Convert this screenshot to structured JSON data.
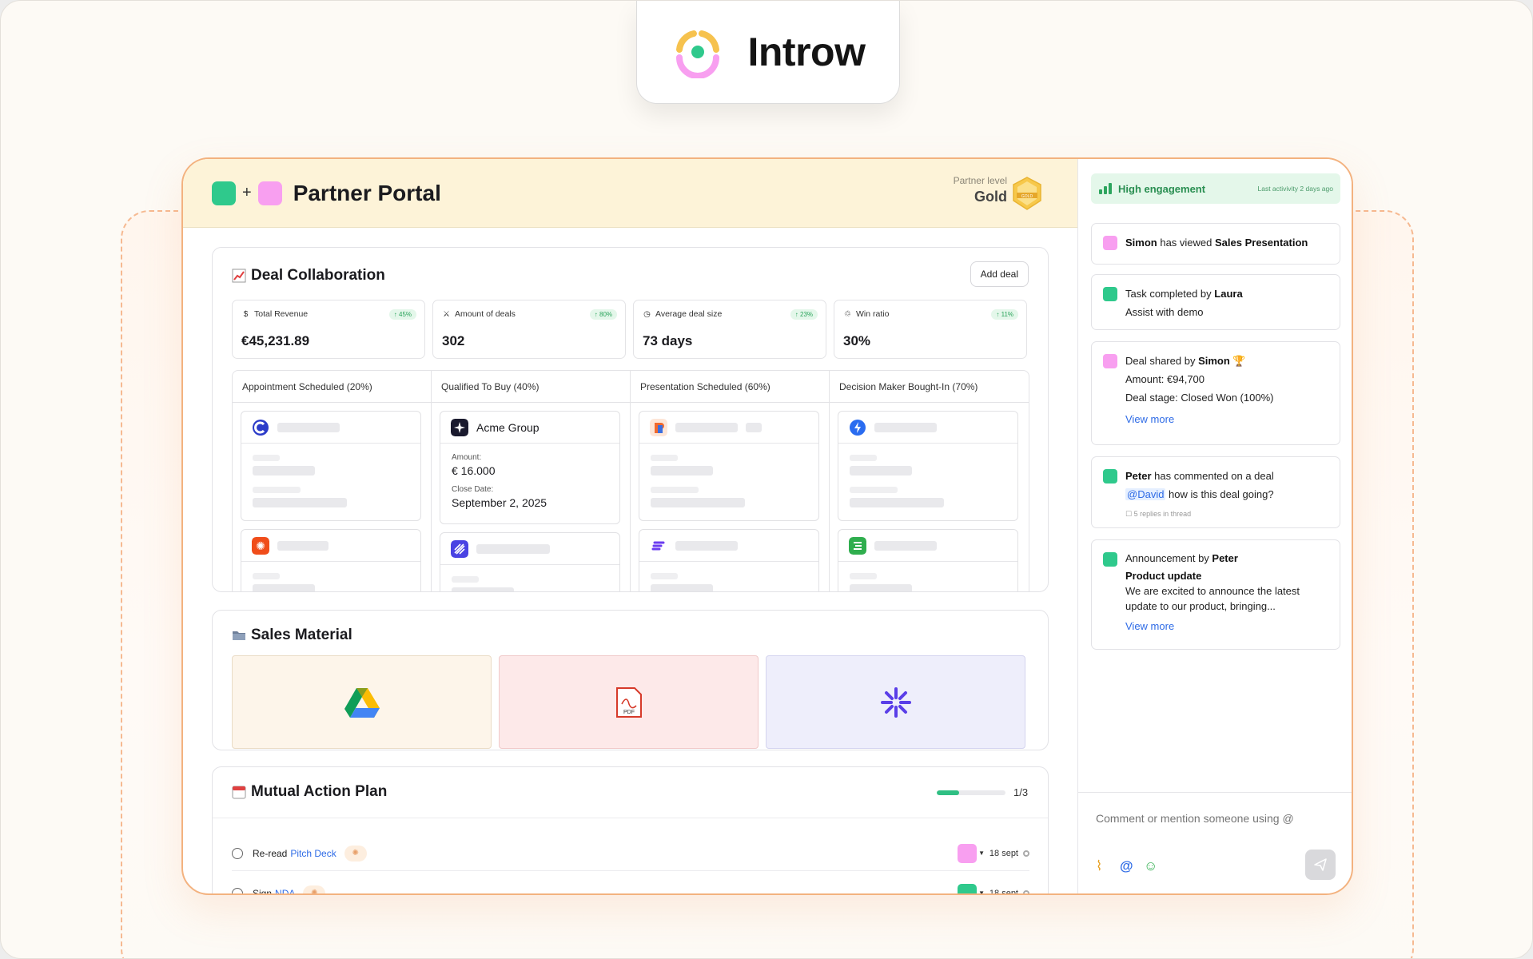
{
  "brand": {
    "name": "Introw"
  },
  "header": {
    "title": "Partner Portal",
    "plus": "+",
    "partner_label": "Partner level",
    "partner_value": "Gold",
    "badge_text": "GOLD"
  },
  "deal_collab": {
    "title": "Deal Collaboration",
    "add_button": "Add deal",
    "kpis": [
      {
        "icon": "dollar-icon",
        "glyph": "$",
        "label": "Total Revenue",
        "change": "↑ 45%",
        "value": "€45,231.89"
      },
      {
        "icon": "handshake-icon",
        "glyph": "⚔",
        "label": "Amount of deals",
        "change": "↑ 80%",
        "value": "302"
      },
      {
        "icon": "clock-icon",
        "glyph": "◷",
        "label": "Average deal size",
        "change": "↑ 23%",
        "value": "73 days"
      },
      {
        "icon": "trophy-icon",
        "glyph": "♲",
        "label": "Win ratio",
        "change": "↑ 11%",
        "value": "30%"
      }
    ],
    "columns": [
      {
        "label": "Appointment Scheduled (20%)"
      },
      {
        "label": "Qualified To Buy (40%)"
      },
      {
        "label": "Presentation Scheduled (60%)"
      },
      {
        "label": "Decision Maker Bought-In (70%)"
      }
    ],
    "featured_deal": {
      "name": "Acme Group",
      "amount_label": "Amount:",
      "amount": "€ 16.000",
      "close_label": "Close Date:",
      "close_date": "September 2, 2025"
    }
  },
  "sales_material": {
    "title": "Sales Material",
    "items": [
      {
        "icon": "google-drive-icon",
        "bg": "#fdf5ea"
      },
      {
        "icon": "pdf-icon",
        "bg": "#fde9e9",
        "text": "PDF"
      },
      {
        "icon": "asterisk-icon",
        "bg": "#eeeefb"
      }
    ]
  },
  "action_plan": {
    "title": "Mutual Action Plan",
    "progress": 0.33,
    "progress_text": "1/3",
    "tasks": [
      {
        "text": "Re-read",
        "link": "Pitch Deck",
        "date": "18 sept",
        "color": "#f89ff0"
      },
      {
        "text": "Sign",
        "link": "NDA",
        "date": "18 sept",
        "color": "#2fc98c"
      }
    ]
  },
  "sidebar": {
    "engagement": "High engagement",
    "last_activity": "Last activivity 2 days ago",
    "activities": [
      {
        "pre": "Simon",
        "mid": " has viewed ",
        "bold2": "Sales Presentation"
      },
      {
        "pre": "Task completed by ",
        "bold": "Laura",
        "line2": "Assist with demo"
      },
      {
        "pre": "Deal shared by ",
        "bold": "Simon",
        "line2": "Amount: €94,700",
        "line3": "Deal stage: Closed Won (100%)",
        "link": "View more"
      },
      {
        "bold": "Peter",
        "pre": " has commented on a deal",
        "mention": "@David",
        "line2": " how is this deal going?",
        "small": "5 replies in thread"
      },
      {
        "pre": "Announcement by ",
        "bold": "Peter",
        "heading": "Product update",
        "line2": "We are excited to announce the latest update to our product, bringing...",
        "link": "View more"
      }
    ],
    "comment_placeholder": "Comment or mention someone using @"
  },
  "colors": {
    "accent_green": "#2fc98c",
    "accent_pink": "#f89ff0",
    "header_bg": "#fdf3d8",
    "link": "#2e6be6"
  }
}
